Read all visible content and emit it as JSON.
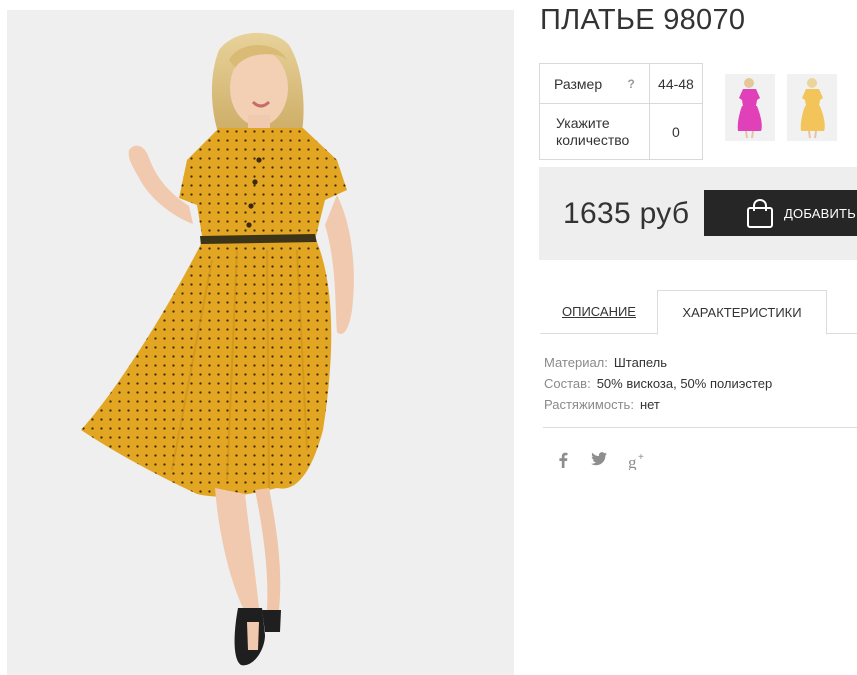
{
  "product": {
    "title": "ПЛАТЬЕ 98070",
    "image_alt": "dress-photo"
  },
  "options": {
    "size_label": "Размер",
    "size_help": "?",
    "size_value": "44-48",
    "qty_label_line1": "Укажите",
    "qty_label_line2": "количество",
    "qty_value": "0"
  },
  "thumbnails": [
    {
      "name": "thumbnail-pink-dress",
      "color": "#e040b8"
    },
    {
      "name": "thumbnail-yellow-dress",
      "color": "#f2c45a"
    }
  ],
  "buy": {
    "price": "1635 руб",
    "add_label": "ДОБАВИТЬ"
  },
  "tabs": [
    {
      "label": "ОПИСАНИЕ",
      "active": false
    },
    {
      "label": "ХАРАКТЕРИСТИКИ",
      "active": true
    }
  ],
  "specs": [
    {
      "key": "Материал:",
      "value": "Штапель"
    },
    {
      "key": "Состав:",
      "value": "50% вискоза, 50% полиэстер"
    },
    {
      "key": "Растяжимость:",
      "value": "нет"
    }
  ],
  "social": [
    "facebook-icon",
    "twitter-icon",
    "google-plus-icon"
  ],
  "colors": {
    "dress": "#e3a623",
    "button": "#262626",
    "buybox_bg": "#eeeeee",
    "photo_bg": "#efefef"
  }
}
